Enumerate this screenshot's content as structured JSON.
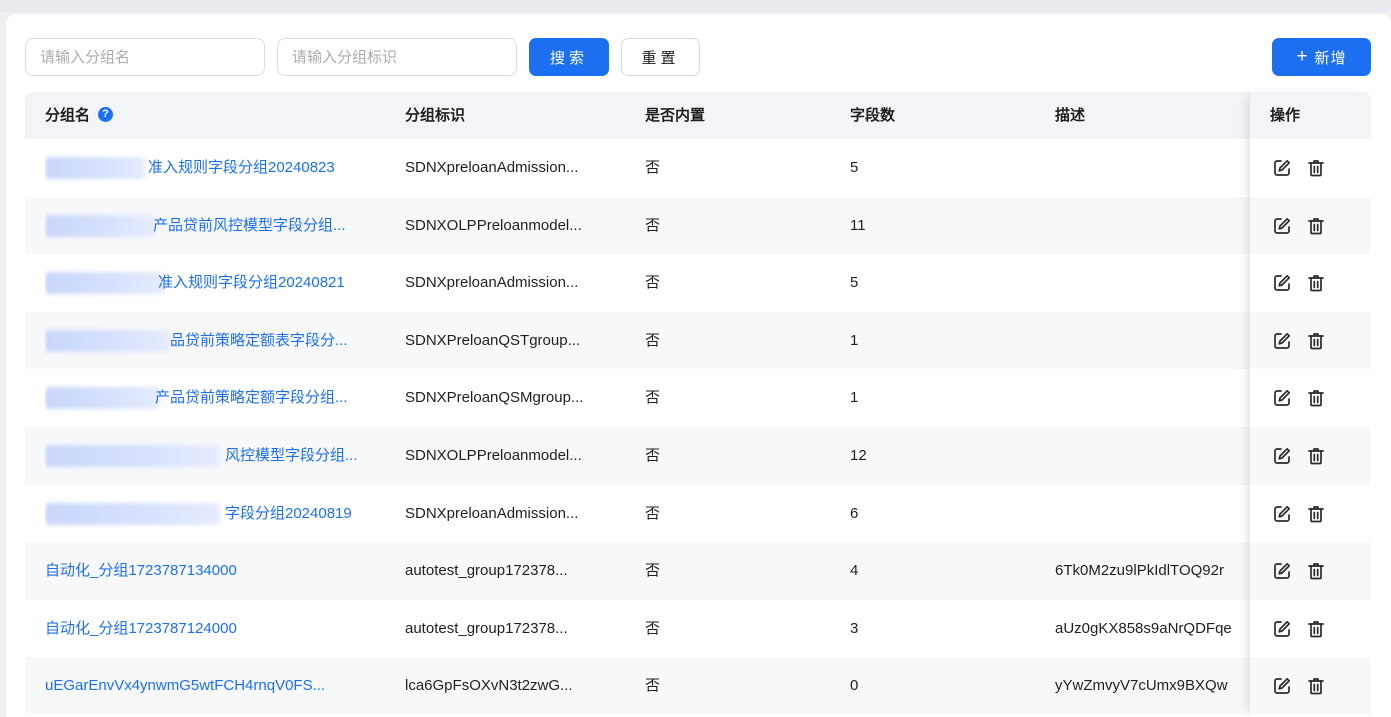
{
  "search": {
    "group_name_placeholder": "请输入分组名",
    "group_ident_placeholder": "请输入分组标识",
    "search_label": "搜索",
    "reset_label": "重置",
    "add_label": "新增"
  },
  "table": {
    "headers": {
      "name": "分组名",
      "ident": "分组标识",
      "builtin": "是否内置",
      "count": "字段数",
      "desc": "描述",
      "ops": "操作"
    },
    "rows": [
      {
        "name": "准入规则字段分组20240823",
        "ident": "SDNXpreloanAdmission...",
        "builtin": "否",
        "count": "5",
        "desc": ""
      },
      {
        "name": "产品贷前风控模型字段分组...",
        "ident": "SDNXOLPPreloanmodel...",
        "builtin": "否",
        "count": "11",
        "desc": ""
      },
      {
        "name": "准入规则字段分组20240821",
        "ident": "SDNXpreloanAdmission...",
        "builtin": "否",
        "count": "5",
        "desc": ""
      },
      {
        "name": "品贷前策略定额表字段分...",
        "ident": "SDNXPreloanQSTgroup...",
        "builtin": "否",
        "count": "1",
        "desc": ""
      },
      {
        "name": "产品贷前策略定额字段分组...",
        "ident": "SDNXPreloanQSMgroup...",
        "builtin": "否",
        "count": "1",
        "desc": ""
      },
      {
        "name": "风控模型字段分组...",
        "ident": "SDNXOLPPreloanmodel...",
        "builtin": "否",
        "count": "12",
        "desc": ""
      },
      {
        "name": "字段分组20240819",
        "ident": "SDNXpreloanAdmission...",
        "builtin": "否",
        "count": "6",
        "desc": ""
      },
      {
        "name": "自动化_分组1723787134000",
        "ident": "autotest_group172378...",
        "builtin": "否",
        "count": "4",
        "desc": "6Tk0M2zu9lPkIdlTOQ92r"
      },
      {
        "name": "自动化_分组1723787124000",
        "ident": "autotest_group172378...",
        "builtin": "否",
        "count": "3",
        "desc": "aUz0gKX858s9aNrQDFqe"
      },
      {
        "name": "uEGarEnvVx4ynwmG5wtFCH4rnqV0FS...",
        "ident": "lca6GpFsOXvN3t2zwG...",
        "builtin": "否",
        "count": "0",
        "desc": "yYwZmvyV7cUmx9BXQw"
      }
    ]
  },
  "icons": {
    "help": "question-circle-icon",
    "edit": "edit-icon",
    "delete": "trash-icon",
    "add": "plus-icon"
  },
  "colors": {
    "primary": "#1d6ff2",
    "link": "#1d6ff2",
    "header_bg": "#f3f4f7"
  }
}
